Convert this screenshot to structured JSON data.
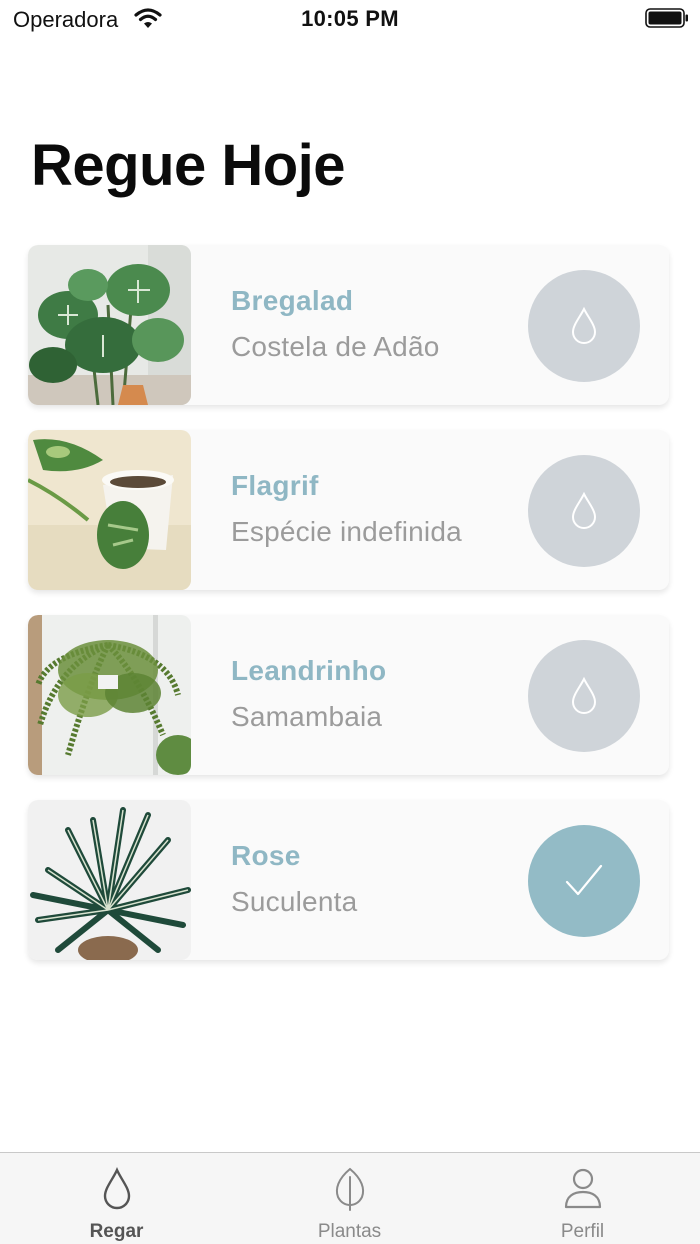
{
  "status_bar": {
    "carrier": "Operadora",
    "time": "10:05 PM"
  },
  "page": {
    "title": "Regue Hoje"
  },
  "plants": [
    {
      "name": "Bregalad",
      "species": "Costela de Adão",
      "watered": false,
      "button_icon": "water-drop-icon"
    },
    {
      "name": "Flagrif",
      "species": "Espécie indefinida",
      "watered": false,
      "button_icon": "water-drop-icon"
    },
    {
      "name": "Leandrinho",
      "species": "Samambaia",
      "watered": false,
      "button_icon": "water-drop-icon"
    },
    {
      "name": "Rose",
      "species": "Suculenta",
      "watered": true,
      "button_icon": "checkmark-icon"
    }
  ],
  "tab_bar": {
    "tabs": [
      {
        "label": "Regar",
        "icon": "water-drop-icon",
        "active": true
      },
      {
        "label": "Plantas",
        "icon": "leaf-icon",
        "active": false
      },
      {
        "label": "Perfil",
        "icon": "person-icon",
        "active": false
      }
    ]
  },
  "colors": {
    "accent": "#8fb7c4",
    "pending_button": "#cfd4d9",
    "done_button": "#93bbc6",
    "card_background": "#fafafa",
    "secondary_text": "#9b9b9b"
  }
}
